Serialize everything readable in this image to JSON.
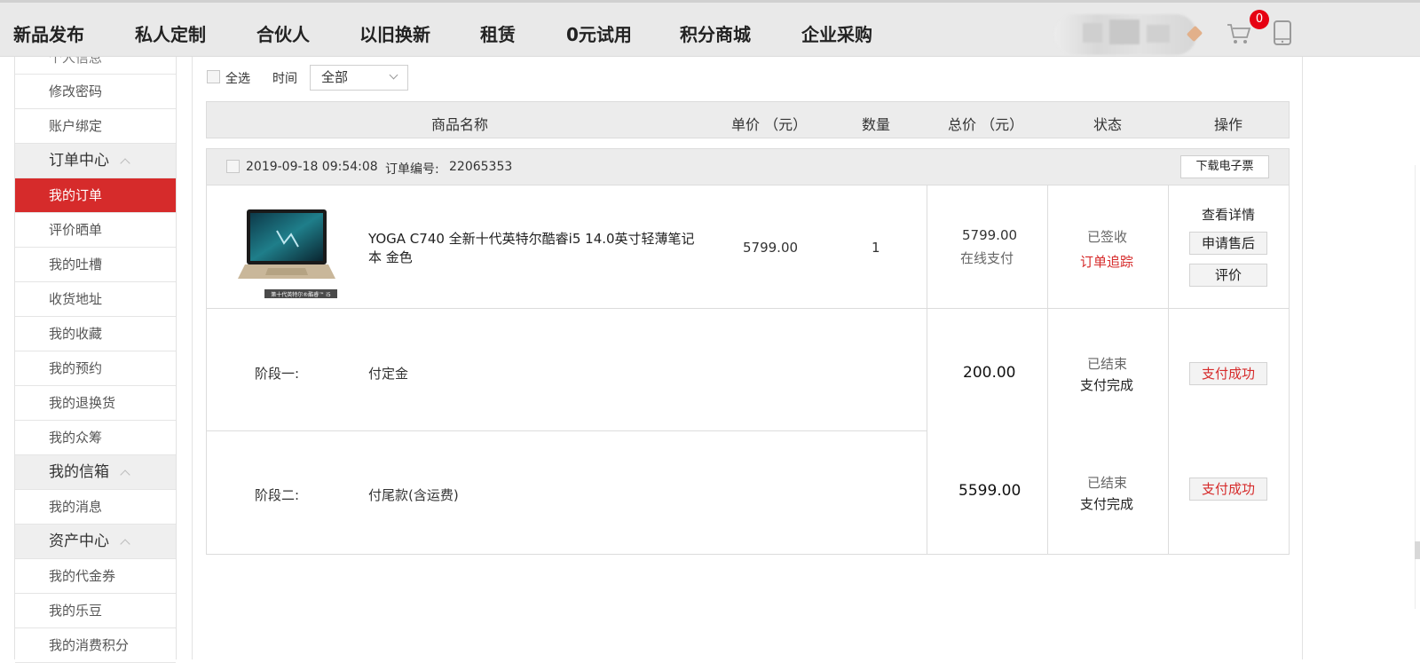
{
  "nav": {
    "items": [
      "新品发布",
      "私人定制",
      "合伙人",
      "以旧换新",
      "租赁",
      "0元试用",
      "积分商城",
      "企业采购"
    ],
    "cart_count": "0"
  },
  "sidebar": {
    "partial_top": "个人信息",
    "items": [
      {
        "label": "修改密码",
        "type": "item"
      },
      {
        "label": "账户绑定",
        "type": "item"
      },
      {
        "label": "订单中心",
        "type": "section"
      },
      {
        "label": "我的订单",
        "type": "active"
      },
      {
        "label": "评价晒单",
        "type": "item"
      },
      {
        "label": "我的吐槽",
        "type": "item"
      },
      {
        "label": "收货地址",
        "type": "item"
      },
      {
        "label": "我的收藏",
        "type": "item"
      },
      {
        "label": "我的预约",
        "type": "item"
      },
      {
        "label": "我的退换货",
        "type": "item"
      },
      {
        "label": "我的众筹",
        "type": "item"
      },
      {
        "label": "我的信箱",
        "type": "section"
      },
      {
        "label": "我的消息",
        "type": "item"
      },
      {
        "label": "资产中心",
        "type": "section"
      },
      {
        "label": "我的代金券",
        "type": "item"
      },
      {
        "label": "我的乐豆",
        "type": "item"
      },
      {
        "label": "我的消费积分",
        "type": "item"
      }
    ]
  },
  "filter": {
    "select_all": "全选",
    "time_label": "时间",
    "time_value": "全部"
  },
  "table_headers": {
    "name": "商品名称",
    "unit_price": "单价 （元）",
    "qty": "数量",
    "total": "总价 （元）",
    "status": "状态",
    "action": "操作"
  },
  "order": {
    "datetime": "2019-09-18 09:54:08",
    "order_no_label": "订单编号:",
    "order_no": "22065353",
    "download_invoice": "下载电子票",
    "product": {
      "name": "YOGA C740 全新十代英特尔酷睿i5 14.0英寸轻薄笔记本 金色",
      "unit_price": "5799.00",
      "qty": "1",
      "total": "5799.00",
      "pay_method": "在线支付",
      "status": "已签收",
      "tracking": "订单追踪",
      "view_details": "查看详情",
      "after_sale": "申请售后",
      "review": "评价",
      "image_caption": "第十代英特尔®酷睿™ i5"
    },
    "stages": [
      {
        "label": "阶段一:",
        "desc": "付定金",
        "amount": "200.00",
        "status1": "已结束",
        "status2": "支付完成",
        "action": "支付成功"
      },
      {
        "label": "阶段二:",
        "desc": "付尾款(含运费)",
        "amount": "5599.00",
        "status1": "已结束",
        "status2": "支付完成",
        "action": "支付成功"
      }
    ]
  }
}
